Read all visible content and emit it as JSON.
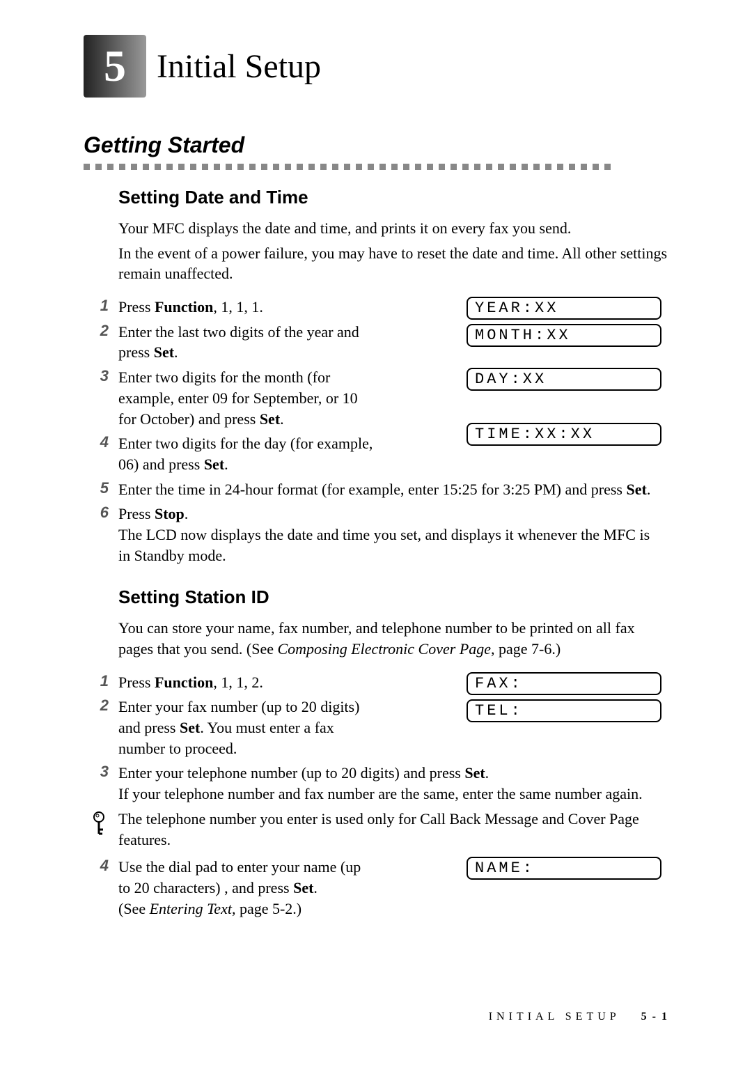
{
  "chapter": {
    "number": "5",
    "title": "Initial Setup"
  },
  "section": {
    "title": "Getting Started"
  },
  "subsection_date": {
    "title": "Setting Date and Time",
    "intro1": "Your MFC displays the date and time, and prints it on every fax you send.",
    "intro2": "In the event of a power failure, you may have to reset the date and time. All other settings remain unaffected.",
    "steps": {
      "s1": {
        "num": "1",
        "text_pre": "Press ",
        "bold": "Function",
        "text_post": ", 1, 1, 1."
      },
      "s2": {
        "num": "2",
        "text_pre": "Enter the last two digits of the year and press ",
        "bold": "Set",
        "text_post": "."
      },
      "s3": {
        "num": "3",
        "text_pre": "Enter two digits for the month (for example, enter 09 for September, or 10 for October) and press ",
        "bold": "Set",
        "text_post": "."
      },
      "s4": {
        "num": "4",
        "text_pre": "Enter two digits for the day (for example, 06) and press ",
        "bold": "Set",
        "text_post": "."
      },
      "s5": {
        "num": "5",
        "text_pre": "Enter the time in 24-hour format (for example, enter 15:25 for 3:25 PM) and press ",
        "bold": "Set",
        "text_post": "."
      },
      "s6": {
        "num": "6",
        "text_pre": "Press ",
        "bold": "Stop",
        "text_post": ".",
        "followup": "The LCD now displays the date and time you set, and displays it whenever the MFC is in Standby mode."
      }
    },
    "lcd": {
      "year": "YEAR:XX",
      "month": "MONTH:XX",
      "day": "DAY:XX",
      "time": "TIME:XX:XX"
    }
  },
  "subsection_station": {
    "title": "Setting Station ID",
    "intro_pre": "You can store your name, fax number, and telephone number to be printed on all fax pages that you send. (See ",
    "intro_ref": "Composing Electronic Cover Page",
    "intro_post": ", page 7-6.)",
    "steps": {
      "s1": {
        "num": "1",
        "text_pre": "Press ",
        "bold": "Function",
        "text_post": ", 1, 1, 2."
      },
      "s2": {
        "num": "2",
        "text_pre": "Enter your fax number (up to 20 digits) and press ",
        "bold": "Set",
        "text_post": ". You must enter a fax number to proceed."
      },
      "s3": {
        "num": "3",
        "text_pre": "Enter your telephone number (up to 20 digits) and press ",
        "bold": "Set",
        "text_post": ".",
        "followup": "If your telephone number and fax number are the same, enter the same number again."
      },
      "s4": {
        "num": "4",
        "text_pre": "Use the dial pad to enter your name (up to 20 characters) , and press ",
        "bold": "Set",
        "text_post": ".",
        "see_pre": "(See ",
        "see_ref": "Entering Text",
        "see_post": ", page 5-2.)"
      }
    },
    "note": "The telephone number you enter is used only for Call Back Message and Cover Page features.",
    "lcd": {
      "fax": "FAX:",
      "tel": "TEL:",
      "name": "NAME:"
    }
  },
  "footer": {
    "label": "INITIAL SETUP",
    "page": "5 - 1"
  }
}
